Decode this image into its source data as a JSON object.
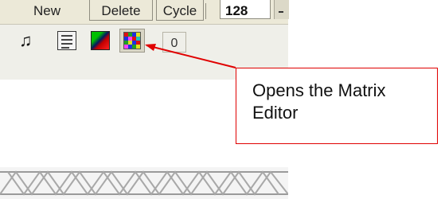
{
  "toolbar": {
    "new_label": "New",
    "delete_label": "Delete",
    "cycle_label": "Cycle",
    "counter_value": "128"
  },
  "icon_row": {
    "icons": [
      "music-note-icon",
      "table-icon",
      "color-gradient-icon",
      "matrix-editor-icon"
    ],
    "value_field": "0"
  },
  "callout": {
    "text": "Opens the Matrix Editor",
    "color": "#e00000"
  },
  "colors": {
    "toolbar_bg": "#ece9d8",
    "callout_border": "#e00000"
  }
}
